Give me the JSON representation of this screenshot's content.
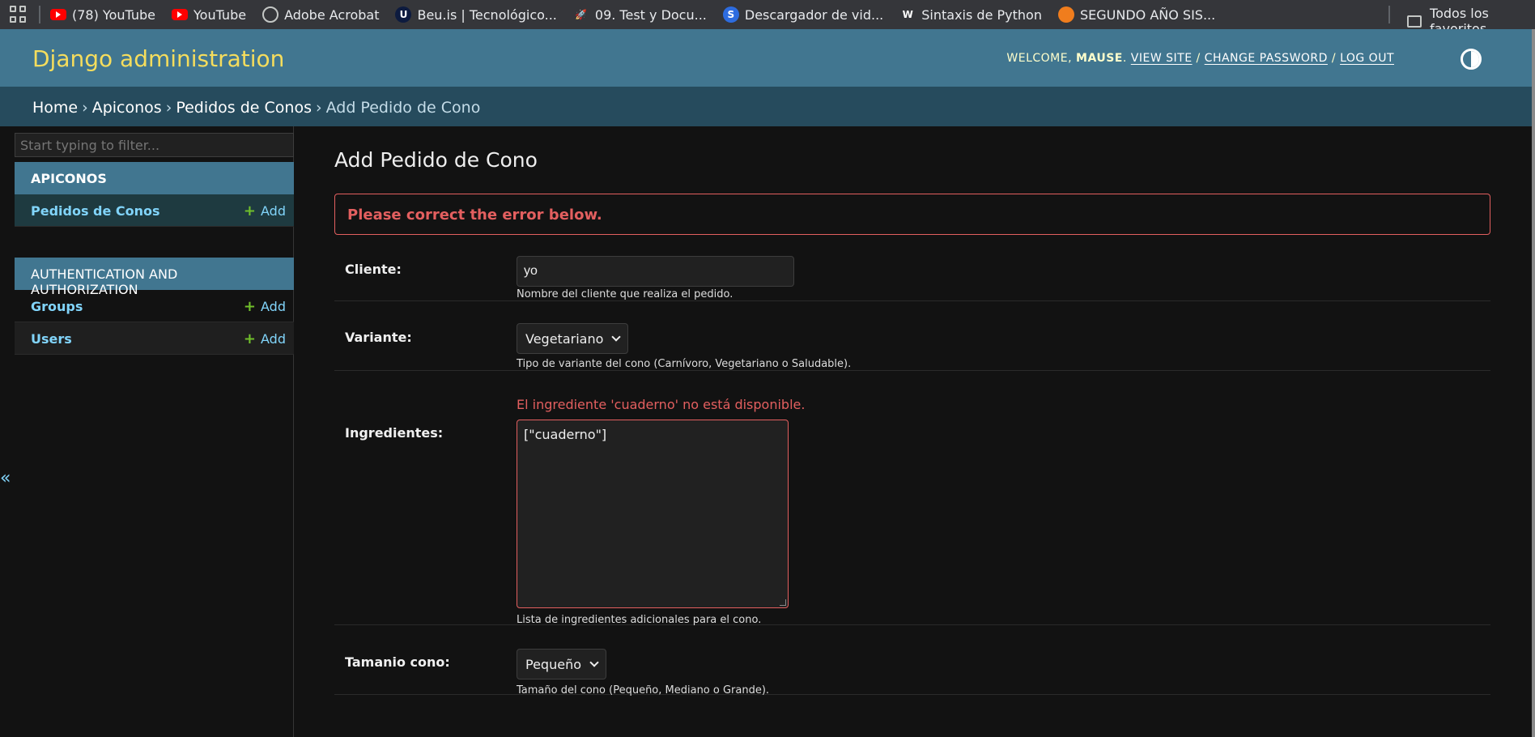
{
  "bookmarks": {
    "items": [
      {
        "icon": "youtube-icon",
        "label": "(78) YouTube"
      },
      {
        "icon": "youtube-icon",
        "label": "YouTube"
      },
      {
        "icon": "globe-icon",
        "label": "Adobe Acrobat"
      },
      {
        "icon": "beu-icon",
        "label": "Beu.is | Tecnológico..."
      },
      {
        "icon": "rocket-icon",
        "label": "09. Test y Docu..."
      },
      {
        "icon": "s-icon",
        "label": "Descargador de vid..."
      },
      {
        "icon": "w-icon",
        "label": "Sintaxis de Python"
      },
      {
        "icon": "segundo-icon",
        "label": "SEGUNDO AÑO SIS..."
      }
    ],
    "all_label": "Todos los favoritos"
  },
  "header": {
    "branding": "Django administration",
    "welcome": "WELCOME,",
    "username": "MAUSE",
    "view_site": "VIEW SITE",
    "change_password": "CHANGE PASSWORD",
    "log_out": "LOG OUT",
    "sep": "/"
  },
  "breadcrumbs": {
    "home": "Home",
    "app": "Apiconos",
    "model": "Pedidos de Conos",
    "current": "Add Pedido de Cono",
    "sep": "›"
  },
  "sidebar": {
    "filter_placeholder": "Start typing to filter...",
    "apps": [
      {
        "caption": "APICONOS",
        "models": [
          {
            "name": "Pedidos de Conos",
            "add": "Add"
          }
        ]
      },
      {
        "caption": "AUTHENTICATION AND AUTHORIZATION",
        "models": [
          {
            "name": "Groups",
            "add": "Add"
          },
          {
            "name": "Users",
            "add": "Add"
          }
        ]
      }
    ],
    "plus": "+",
    "collapse": "«"
  },
  "content": {
    "title": "Add Pedido de Cono",
    "errornote": "Please correct the error below.",
    "fields": {
      "cliente": {
        "label": "Cliente:",
        "value": "yo",
        "help": "Nombre del cliente que realiza el pedido."
      },
      "variante": {
        "label": "Variante:",
        "value": "Vegetariano",
        "help": "Tipo de variante del cono (Carnívoro, Vegetariano o Saludable)."
      },
      "ingredientes": {
        "label": "Ingredientes:",
        "error": "El ingrediente 'cuaderno' no está disponible.",
        "value": "[\"cuaderno\"]",
        "help": "Lista de ingredientes adicionales para el cono."
      },
      "tamanio": {
        "label": "Tamanio cono:",
        "value": "Pequeño",
        "help": "Tamaño del cono (Pequeño, Mediano o Grande)."
      }
    }
  },
  "colors": {
    "header": "#417690",
    "breadcrumbs": "#264b5d",
    "branding": "#f5dd5d",
    "error": "#e35f5f",
    "link": "#81d4fa",
    "add_plus": "#70bf2b"
  }
}
